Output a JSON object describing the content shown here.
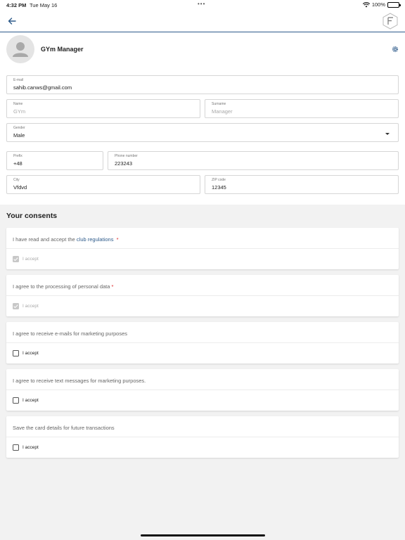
{
  "status_bar": {
    "time": "4:32 PM",
    "date": "Tue May 16",
    "dots": "•••",
    "battery": "100%"
  },
  "profile": {
    "name": "GYm Manager"
  },
  "form": {
    "email": {
      "label": "E-mail",
      "value": "sahib.canws@gmail.com"
    },
    "name": {
      "label": "Name",
      "placeholder": "GYm"
    },
    "surname": {
      "label": "Surname",
      "placeholder": "Manager"
    },
    "gender": {
      "label": "Gender",
      "value": "Male"
    },
    "prefix": {
      "label": "Prefix",
      "value": "+48"
    },
    "phone": {
      "label": "Phone number",
      "value": "223243"
    },
    "city": {
      "label": "City",
      "value": "Vfdvd"
    },
    "zip": {
      "label": "ZIP code",
      "value": "12345"
    }
  },
  "consents": {
    "title": "Your consents",
    "accept_label": "I accept",
    "required_mark": "*",
    "items": [
      {
        "text": "I have read and accept the ",
        "link": "club regulations",
        "required": true,
        "checked": true
      },
      {
        "text": "I agree to the processing of personal data",
        "required": true,
        "checked": true
      },
      {
        "text": "I agree to receive e-mails for marketing purposes",
        "required": false,
        "checked": false
      },
      {
        "text": "I agree to receive text messages for marketing purposes.",
        "required": false,
        "checked": false
      },
      {
        "text": "Save the card details for future transactions",
        "required": false,
        "checked": false
      }
    ]
  }
}
